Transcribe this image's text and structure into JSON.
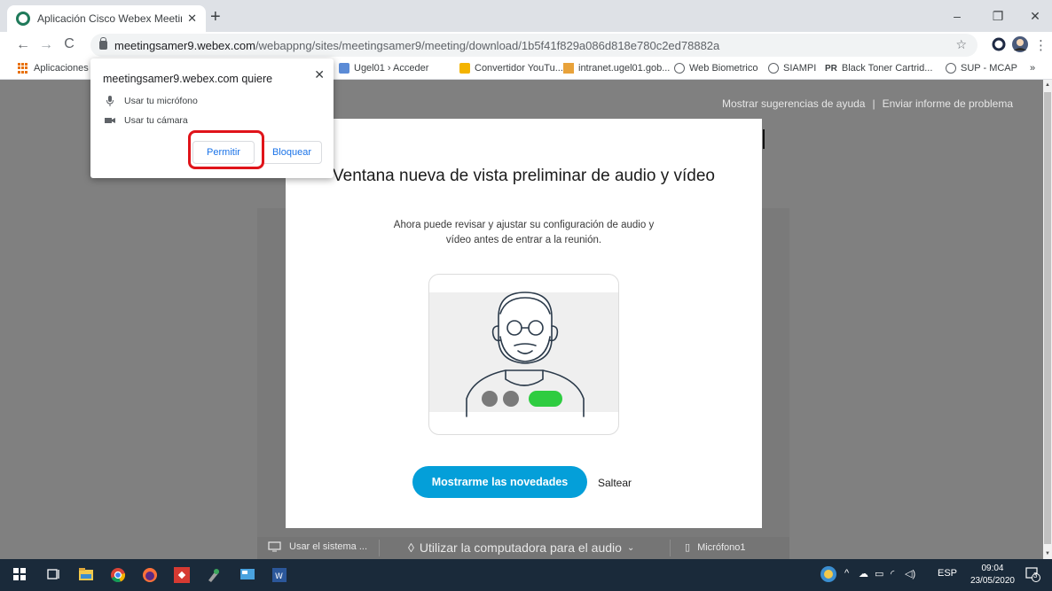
{
  "browser": {
    "tab_title": "Aplicación Cisco Webex Meeting",
    "tab_close": "✕",
    "new_tab": "+",
    "url_domain": "meetingsamer9.webex.com",
    "url_path": "/webappng/sites/meetingsamer9/meeting/download/1b5f41f829a086d818e780c2ed78882a",
    "window_minimize": "–",
    "window_restore": "❐",
    "window_close": "✕"
  },
  "bookmarks": [
    {
      "label": "Aplicaciones",
      "icon": "apps-grid-icon"
    },
    {
      "label": "Ugel01 › Acceder",
      "icon": "ugel-icon"
    },
    {
      "label": "Convertidor YouTu...",
      "icon": "converter-icon"
    },
    {
      "label": "intranet.ugel01.gob...",
      "icon": "pma-icon"
    },
    {
      "label": "Web Biometrico",
      "icon": "globe-icon"
    },
    {
      "label": "SIAMPI",
      "icon": "globe-icon"
    },
    {
      "label": "Black Toner Cartrid...",
      "icon": "pr-icon"
    },
    {
      "label": "SUP - MCAP",
      "icon": "globe-icon"
    }
  ],
  "bookmarks_more": "»",
  "page": {
    "help_link": "Mostrar sugerencias de ayuda",
    "separator": "|",
    "report_link": "Enviar informe de problema"
  },
  "modal": {
    "title": "Ventana nueva de vista preliminar de audio y vídeo",
    "subtitle": "Ahora puede revisar y ajustar su configuración de audio y vídeo antes de entrar a la reunión.",
    "primary_button": "Mostrarme las novedades",
    "skip_link": "Saltear"
  },
  "bottom_bar": {
    "system_label": "Usar el sistema ...",
    "audio_label": "Utilizar la computadora para el audio",
    "mic_label": "Micrófono1"
  },
  "permission_popup": {
    "title": "meetingsamer9.webex.com quiere",
    "close": "✕",
    "mic": "Usar tu micrófono",
    "camera": "Usar tu cámara",
    "allow": "Permitir",
    "block": "Bloquear"
  },
  "taskbar": {
    "language": "ESP",
    "time": "09:04",
    "date": "23/05/2020",
    "notifications": "3"
  },
  "colors": {
    "webex_blue": "#049fd9",
    "highlight_red": "#e0141a",
    "overlay_gray": "#808080",
    "toggle_green": "#2ecc40"
  }
}
